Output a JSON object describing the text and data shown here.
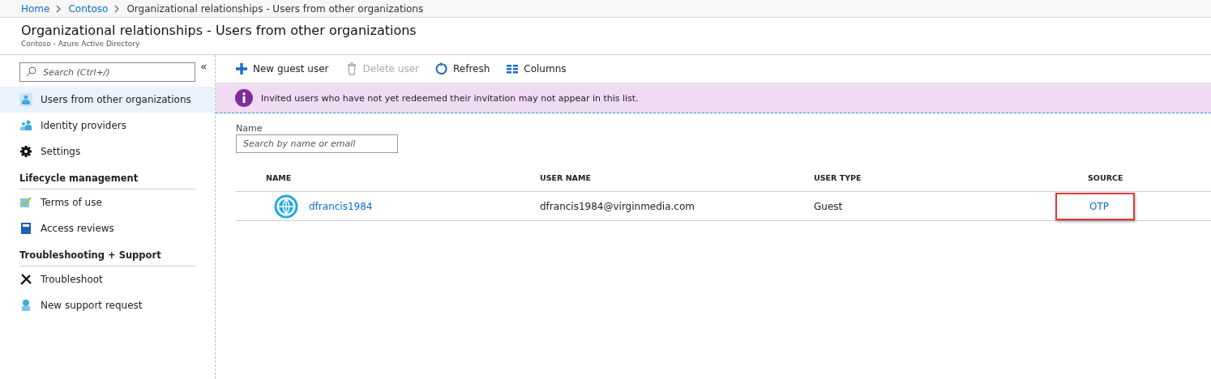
{
  "breadcrumb": [
    {
      "label": "Home",
      "link": true
    },
    {
      "label": "Contoso",
      "link": true
    },
    {
      "label": "Organizational relationships - Users from other organizations",
      "link": false
    }
  ],
  "header": {
    "title": "Organizational relationships - Users from other organizations",
    "subtitle": "Contoso - Azure Active Directory"
  },
  "sidebar": {
    "collapse": "«",
    "search": {
      "placeholder": "Search (Ctrl+/)"
    },
    "sections": [
      {
        "items": [
          {
            "label": "Users from other organizations",
            "selected": true
          },
          {
            "label": "Identity providers",
            "selected": false
          },
          {
            "label": "Settings",
            "selected": false
          }
        ]
      },
      {
        "heading": "Lifecycle management",
        "items": [
          {
            "label": "Terms of use",
            "selected": false
          },
          {
            "label": "Access reviews",
            "selected": false
          }
        ]
      },
      {
        "heading": "Troubleshooting + Support",
        "items": [
          {
            "label": "Troubleshoot",
            "selected": false
          },
          {
            "label": "New support request",
            "selected": false
          }
        ]
      }
    ]
  },
  "toolbar": [
    {
      "label": "New guest user",
      "disabled": false
    },
    {
      "label": "Delete user",
      "disabled": true
    },
    {
      "label": "Refresh",
      "disabled": false
    },
    {
      "label": "Columns",
      "disabled": false
    }
  ],
  "banner": {
    "text": "Invited users who have not yet redeemed their invitation may not appear in this list."
  },
  "filter": {
    "label": "Name",
    "placeholder": "Search by name or email"
  },
  "table": {
    "columns": [
      "NAME",
      "USER NAME",
      "USER TYPE",
      "SOURCE"
    ],
    "rows": [
      {
        "name": "dfrancis1984",
        "user_name": "dfrancis1984@virginmedia.com",
        "user_type": "Guest",
        "source": "OTP",
        "source_highlighted": true
      }
    ]
  }
}
